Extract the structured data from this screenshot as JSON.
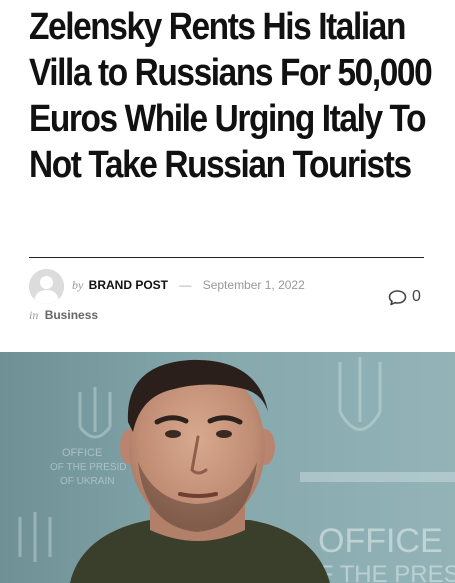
{
  "article": {
    "title": "Zelensky Rents His Italian Villa to Russians For 50,000 Euros While Urging Italy To Not Take Russian Tourists",
    "meta": {
      "by_prefix": "by",
      "author": "BRAND POST",
      "separator": "—",
      "date": "September 1, 2022",
      "in_prefix": "in",
      "category": "Business",
      "comment_count": "0"
    },
    "featured_image": {
      "backdrop_text": [
        "OFFICE",
        "OF THE PRESI"
      ],
      "small_backdrop_text": [
        "OFFICE",
        "OF THE PRESID",
        "OF UKRAIN"
      ]
    }
  },
  "colors": {
    "title": "#111111",
    "meta_muted": "#999999",
    "image_backdrop": "#7fa1a7"
  }
}
